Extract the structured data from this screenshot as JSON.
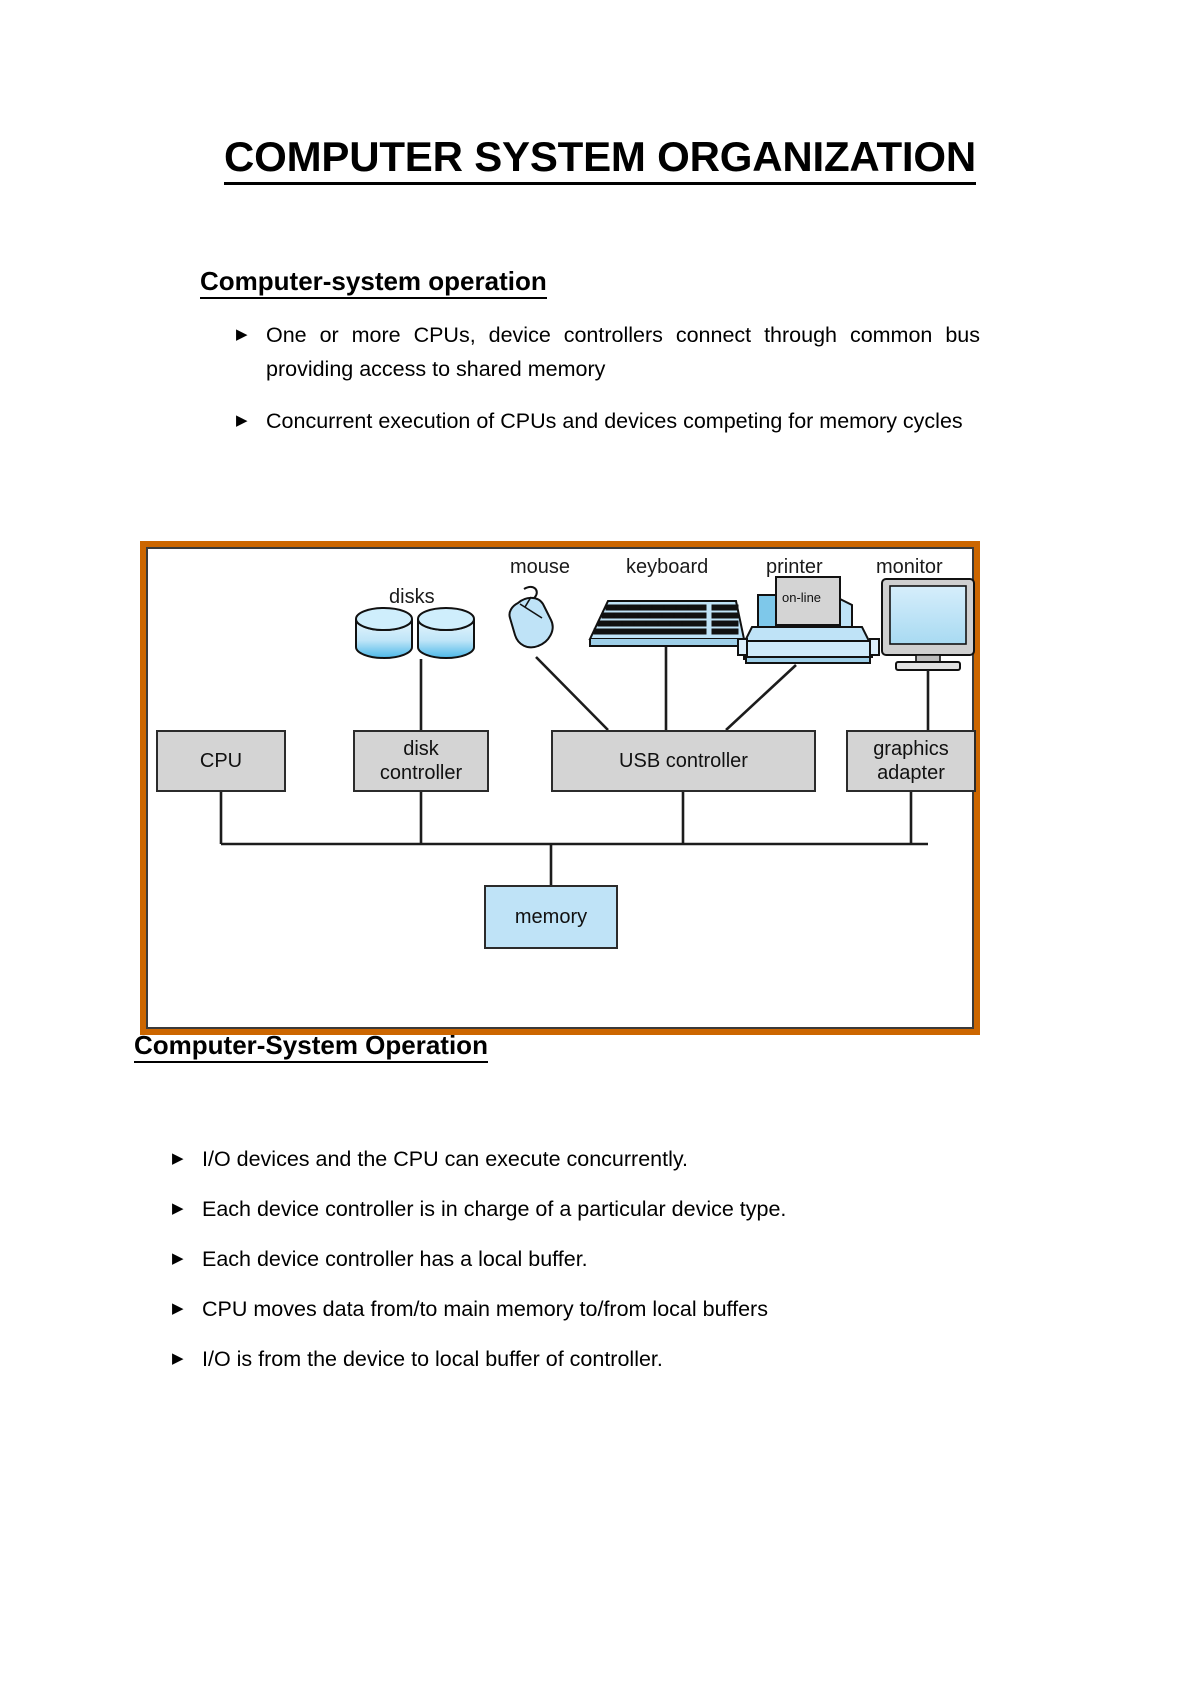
{
  "document": {
    "title": "COMPUTER SYSTEM ORGANIZATION"
  },
  "sections": [
    {
      "heading": "Computer-system operation",
      "bullets": [
        "One or more CPUs, device controllers connect through common bus providing access to shared memory",
        "Concurrent execution of CPUs and devices competing for memory cycles"
      ]
    },
    {
      "heading": "Computer-System Operation",
      "bullets": [
        "I/O devices and the CPU can execute concurrently.",
        "Each device controller is in charge of a particular device type.",
        "Each device controller has a local buffer.",
        "CPU moves data from/to main memory to/from local buffers",
        "I/O is from the device to local buffer of controller."
      ]
    }
  ],
  "figure": {
    "frame_color": "#CC6600",
    "device_labels": {
      "disks": "disks",
      "mouse": "mouse",
      "keyboard": "keyboard",
      "printer": "printer",
      "monitor": "monitor"
    },
    "printer_status": "on-line",
    "boxes": {
      "cpu": "CPU",
      "disk_controller": "disk\ncontroller",
      "disk_controller_line1": "disk",
      "disk_controller_line2": "controller",
      "usb_controller": "USB controller",
      "graphics_adapter_line1": "graphics",
      "graphics_adapter_line2": "adapter",
      "memory": "memory"
    },
    "box_colors": {
      "controller_grey": "#d4d4d4",
      "memory_blue": "#bfe3f7",
      "device_blue": "#bfe3f7"
    }
  }
}
